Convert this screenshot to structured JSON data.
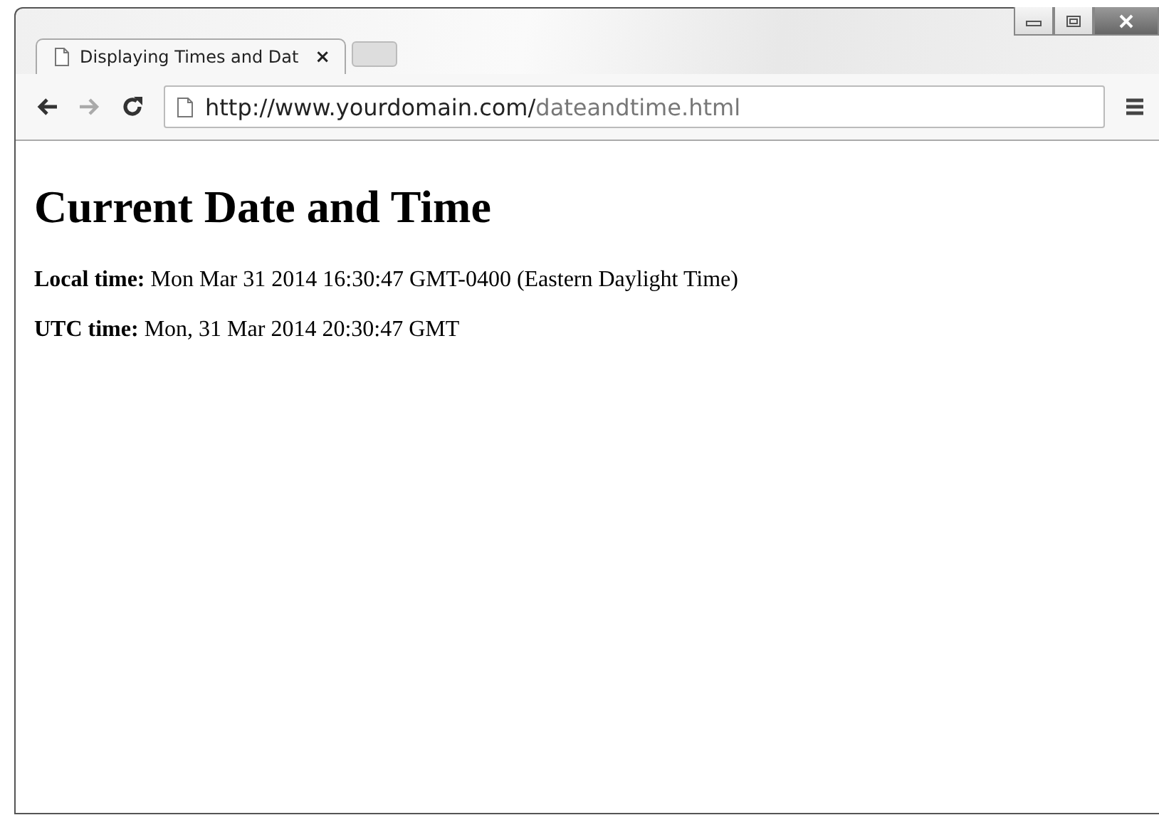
{
  "tabs": [
    {
      "title": "Displaying Times and Dat",
      "close": "×",
      "selected": true
    }
  ],
  "address": {
    "host": "http://www.yourdomain.com/",
    "path": "dateandtime.html"
  },
  "page": {
    "heading": "Current Date and Time",
    "lines": [
      "**Local time:** Mon Mar 31 2014 16:30:47 GMT-0400 (Eastern Daylight Time)",
      "**UTC time:** Mon, 31 Mar 2014 20:30:47 GMT"
    ]
  }
}
